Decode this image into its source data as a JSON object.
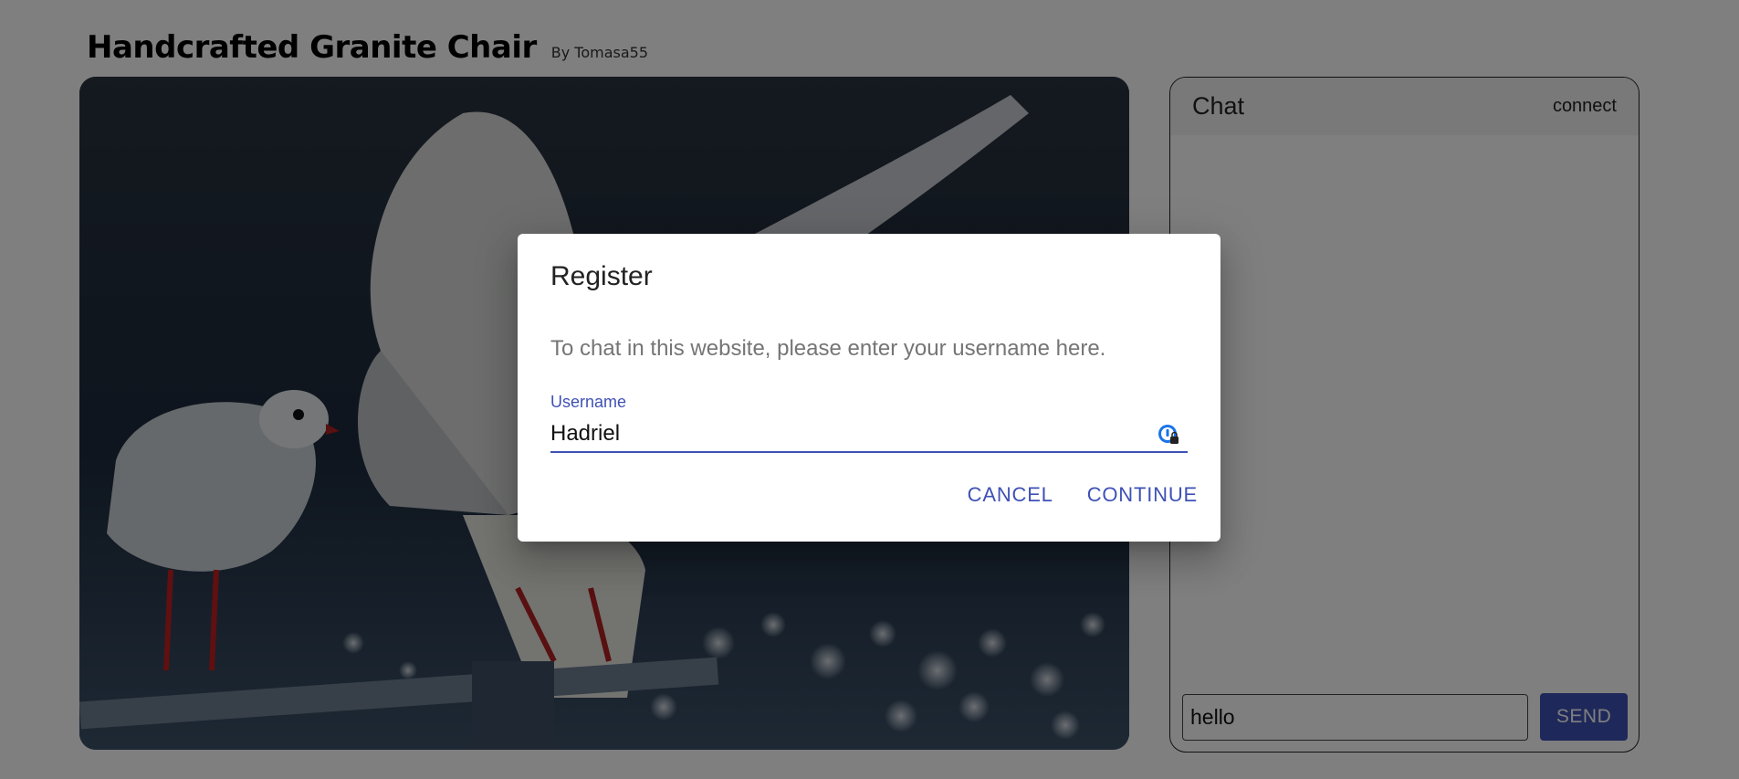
{
  "page": {
    "title": "Handcrafted Granite Chair",
    "byline": "By Tomasa55"
  },
  "media": {
    "image_subject": "seagulls-photo"
  },
  "chat": {
    "title": "Chat",
    "connect_label": "connect",
    "message_input_value": "hello",
    "send_label": "SEND"
  },
  "dialog": {
    "title": "Register",
    "description": "To chat in this website, please enter your username here.",
    "username_label": "Username",
    "username_value": "Hadriel",
    "cancel_label": "CANCEL",
    "continue_label": "CONTINUE"
  },
  "colors": {
    "primary": "#3f51b5",
    "backdrop": "rgba(0,0,0,0.5)"
  }
}
